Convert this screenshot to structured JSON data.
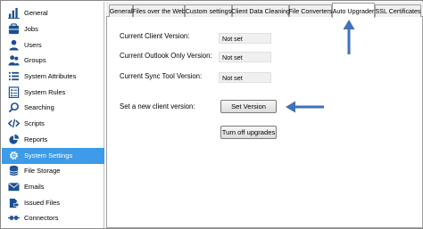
{
  "sidebar": {
    "items": [
      {
        "label": "General",
        "icon": "bar-chart-icon"
      },
      {
        "label": "Jobs",
        "icon": "jobs-icon"
      },
      {
        "label": "Users",
        "icon": "user-icon"
      },
      {
        "label": "Groups",
        "icon": "group-icon"
      },
      {
        "label": "System Attributes",
        "icon": "list-icon"
      },
      {
        "label": "System Rules",
        "icon": "rules-icon"
      },
      {
        "label": "Searching",
        "icon": "search-icon"
      },
      {
        "label": "Scripts",
        "icon": "code-icon"
      },
      {
        "label": "Reports",
        "icon": "pie-chart-icon"
      },
      {
        "label": "System Settings",
        "icon": "gear-icon",
        "active": true
      },
      {
        "label": "File Storage",
        "icon": "database-icon"
      },
      {
        "label": "Emails",
        "icon": "envelope-icon"
      },
      {
        "label": "Issued Files",
        "icon": "issued-files-icon"
      },
      {
        "label": "Connectors",
        "icon": "connector-icon"
      }
    ]
  },
  "tabs": [
    {
      "label": "General"
    },
    {
      "label": "Files over the Web"
    },
    {
      "label": "Custom settings"
    },
    {
      "label": "Client Data Cleaning"
    },
    {
      "label": "File Converters"
    },
    {
      "label": "Auto Upgrader",
      "active": true
    },
    {
      "label": "SSL Certificates"
    }
  ],
  "auto_upgrader": {
    "current_client_version_label": "Current Client Version:",
    "current_client_version_value": "Not set",
    "current_outlook_version_label": "Current Outlook Only Version:",
    "current_outlook_version_value": "Not set",
    "current_sync_tool_version_label": "Current Sync Tool Version:",
    "current_sync_tool_version_value": "Not set",
    "set_new_version_label": "Set a new client version:",
    "set_version_button": "Set Version",
    "turn_off_upgrades_button": "Turn off upgrades"
  },
  "colors": {
    "accent": "#3d9be9",
    "icon": "#1b4f93",
    "annotation_arrow": "#3f72b8"
  }
}
